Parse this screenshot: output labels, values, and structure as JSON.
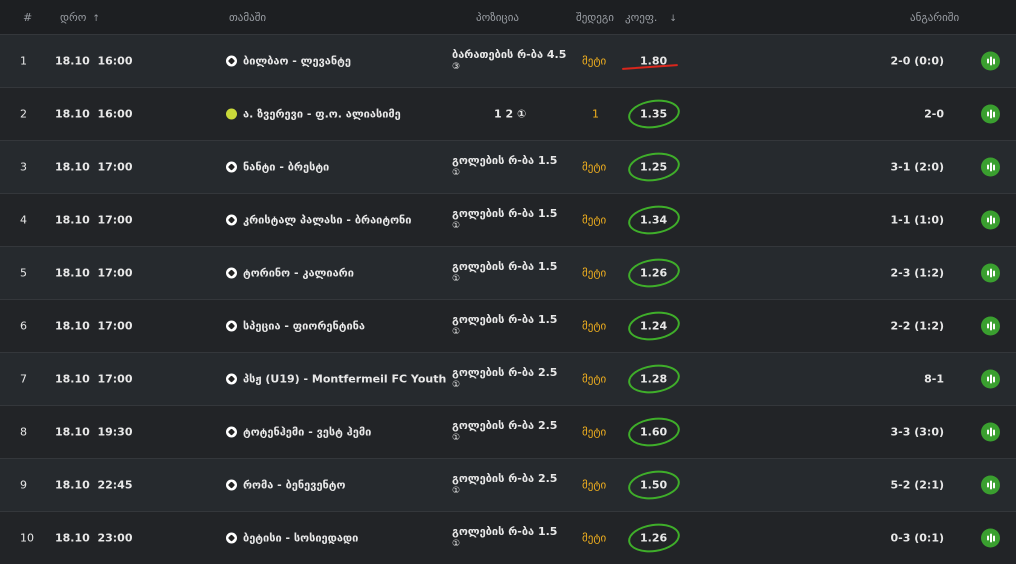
{
  "header": {
    "num": "#",
    "time": "დრო",
    "game": "თამაში",
    "position": "პოზიცია",
    "choice": "შედეგი",
    "odds": "კოეფ.",
    "result": "ანგარიში"
  },
  "rows": [
    {
      "num": "1",
      "date": "18.10",
      "time": "16:00",
      "sport": "soccer",
      "game": "ბილბაო - ლევანტე",
      "pos": "ბარათების რ-ბა 4.5",
      "pos_sub": "③",
      "choice": "მეტი",
      "odds": "1.80",
      "result": "2-0 (0:0)",
      "mark": "red"
    },
    {
      "num": "2",
      "date": "18.10",
      "time": "16:00",
      "sport": "tennis",
      "game": "ა. ზვერევი - ფ.ო. ალიასიმე",
      "pos": "1 2 ①",
      "pos_sub": "",
      "choice": "1",
      "odds": "1.35",
      "result": "2-0",
      "mark": "green"
    },
    {
      "num": "3",
      "date": "18.10",
      "time": "17:00",
      "sport": "soccer",
      "game": "ნანტი - ბრესტი",
      "pos": "გოლების რ-ბა 1.5",
      "pos_sub": "①",
      "choice": "მეტი",
      "odds": "1.25",
      "result": "3-1 (2:0)",
      "mark": "green"
    },
    {
      "num": "4",
      "date": "18.10",
      "time": "17:00",
      "sport": "soccer",
      "game": "კრისტალ პალასი - ბრაიტონი",
      "pos": "გოლების რ-ბა 1.5",
      "pos_sub": "①",
      "choice": "მეტი",
      "odds": "1.34",
      "result": "1-1 (1:0)",
      "mark": "green"
    },
    {
      "num": "5",
      "date": "18.10",
      "time": "17:00",
      "sport": "soccer",
      "game": "ტორინო - კალიარი",
      "pos": "გოლების რ-ბა 1.5",
      "pos_sub": "①",
      "choice": "მეტი",
      "odds": "1.26",
      "result": "2-3 (1:2)",
      "mark": "green"
    },
    {
      "num": "6",
      "date": "18.10",
      "time": "17:00",
      "sport": "soccer",
      "game": "სპეცია - ფიორენტინა",
      "pos": "გოლების რ-ბა 1.5",
      "pos_sub": "①",
      "choice": "მეტი",
      "odds": "1.24",
      "result": "2-2 (1:2)",
      "mark": "green"
    },
    {
      "num": "7",
      "date": "18.10",
      "time": "17:00",
      "sport": "soccer",
      "game": "პსჟ (U19) - Montfermeil FC Youth",
      "pos": "გოლების რ-ბა 2.5",
      "pos_sub": "①",
      "choice": "მეტი",
      "odds": "1.28",
      "result": "8-1",
      "mark": "green"
    },
    {
      "num": "8",
      "date": "18.10",
      "time": "19:30",
      "sport": "soccer",
      "game": "ტოტენჰემი - ვესტ ჰემი",
      "pos": "გოლების რ-ბა 2.5",
      "pos_sub": "①",
      "choice": "მეტი",
      "odds": "1.60",
      "result": "3-3 (3:0)",
      "mark": "green"
    },
    {
      "num": "9",
      "date": "18.10",
      "time": "22:45",
      "sport": "soccer",
      "game": "რომა - ბენევენტო",
      "pos": "გოლების რ-ბა 2.5",
      "pos_sub": "①",
      "choice": "მეტი",
      "odds": "1.50",
      "result": "5-2 (2:1)",
      "mark": "green"
    },
    {
      "num": "10",
      "date": "18.10",
      "time": "23:00",
      "sport": "soccer",
      "game": "ბეტისი - სოსიედადი",
      "pos": "გოლების რ-ბა 1.5",
      "pos_sub": "①",
      "choice": "მეტი",
      "odds": "1.26",
      "result": "0-3 (0:1)",
      "mark": "green"
    }
  ],
  "colors": {
    "accent_green": "#3a9f2f",
    "choice_yellow": "#f2b01e",
    "mark_red": "#d9261c"
  }
}
